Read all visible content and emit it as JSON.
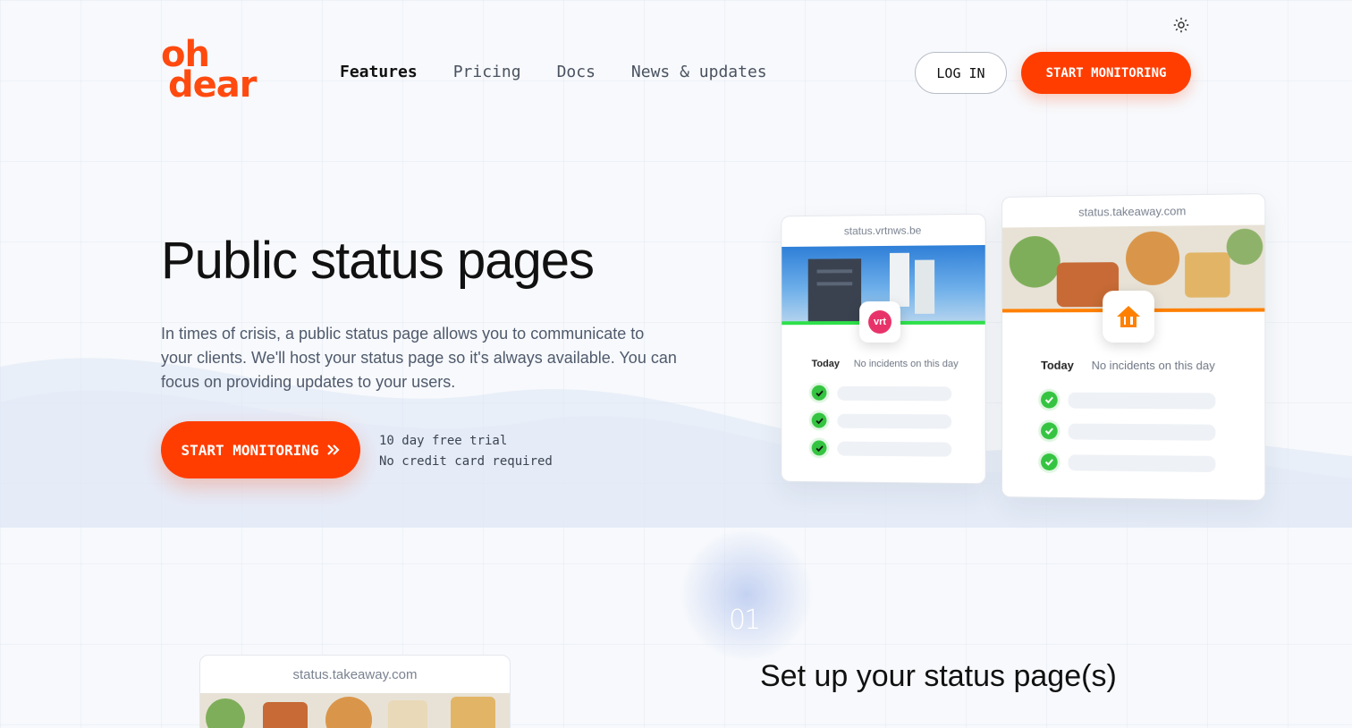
{
  "header": {
    "logo_line1": "oh",
    "logo_line2": "dear",
    "nav": [
      {
        "label": "Features"
      },
      {
        "label": "Pricing"
      },
      {
        "label": "Docs"
      },
      {
        "label": "News & updates"
      }
    ],
    "login_label": "LOG IN",
    "start_label": "START MONITORING",
    "theme_icon": "sun-icon"
  },
  "hero": {
    "title": "Public status pages",
    "description": "In times of crisis, a public status page allows you to communicate to your clients. We'll host your status page so it's always available. You can focus on providing updates to your users.",
    "cta_label": "START MONITORING",
    "trial_line1": "10 day free trial",
    "trial_line2": "No credit card required"
  },
  "cards": [
    {
      "url": "status.vrtnws.be",
      "logo_text": "vrt",
      "today": "Today",
      "status": "No incidents on this day",
      "accent": "#2ee04a"
    },
    {
      "url": "status.takeaway.com",
      "today": "Today",
      "status": "No incidents on this day",
      "accent": "#ff8000"
    }
  ],
  "step": {
    "number": "01",
    "title": "Set up your status page(s)",
    "preview_url": "status.takeaway.com"
  },
  "colors": {
    "brand": "#ff3d00",
    "check": "#35c441"
  }
}
